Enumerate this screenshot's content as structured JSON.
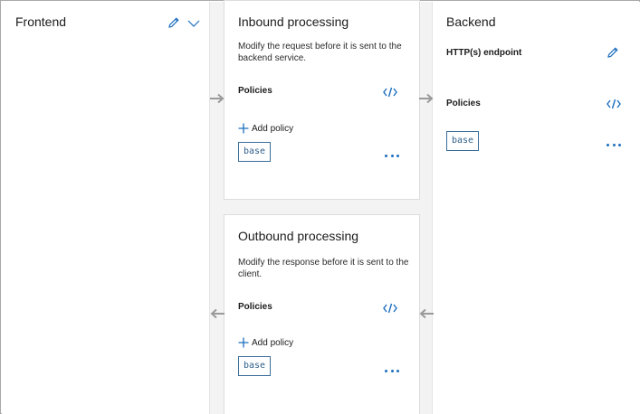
{
  "frontend": {
    "title": "Frontend"
  },
  "inbound": {
    "title": "Inbound processing",
    "description": "Modify the request before it is sent to the backend service.",
    "policies_label": "Policies",
    "add_policy_label": "Add policy",
    "base_label": "base"
  },
  "outbound": {
    "title": "Outbound processing",
    "description": "Modify the response before it is sent to the client.",
    "policies_label": "Policies",
    "add_policy_label": "Add policy",
    "base_label": "base"
  },
  "backend": {
    "title": "Backend",
    "endpoint_label": "HTTP(s) endpoint",
    "policies_label": "Policies",
    "base_label": "base"
  },
  "colors": {
    "accent": "#1d6fbf",
    "arrow": "#9a9a9a",
    "chip_border": "#3a6d9a"
  }
}
